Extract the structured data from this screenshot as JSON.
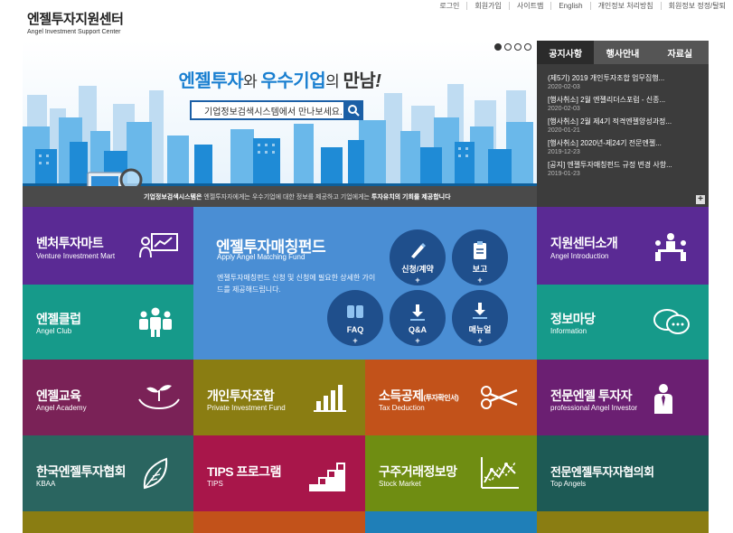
{
  "logo": {
    "ko": "엔젤투자지원센터",
    "en": "Angel Investment Support Center"
  },
  "topnav": [
    "로그인",
    "회원가입",
    "사이트맵",
    "English",
    "개인정보 처리방침",
    "회원정보 정정/탈퇴"
  ],
  "hero": {
    "title_a": "엔젤투자",
    "title_b": "와 ",
    "title_c": "우수기업",
    "title_d": "의 ",
    "title_e": "만남",
    "title_f": "!",
    "search_placeholder": "기업정보검색시스템에서 만나보세요.",
    "caption_bold": "기업정보검색시스템은",
    "caption_mid": " 엔젤투자자에게는 우수기업에 대한 정보를 제공하고 기업에게는 ",
    "caption_end": "투자유치의 기회를 제공합니다",
    "slides": 4,
    "active_slide": 1
  },
  "notice": {
    "tabs": [
      "공지사항",
      "행사안내",
      "자료실"
    ],
    "items": [
      {
        "title": "(제5기) 2019 개인투자조합 업무집행...",
        "date": "2020-02-03"
      },
      {
        "title": "[행사취소] 2월 엔젤리더스포럼 - 신종...",
        "date": "2020-02-03"
      },
      {
        "title": "[행사취소] 2월 제4기 적격엔젤양성과정...",
        "date": "2020-01-21"
      },
      {
        "title": "[행사취소] 2020년-제24기 전문엔젤...",
        "date": "2019-12-23"
      },
      {
        "title": "[공지] 엔젤투자매칭펀드 규정 변경 사항...",
        "date": "2019-01-23"
      }
    ],
    "more": "+"
  },
  "fund": {
    "ko": "엔젤투자매칭펀드",
    "en": "Apply Angel Matching Fund",
    "desc": "엔젤투자매칭펀드 신청 및 신청에 필요한 상세한 가이드를 제공해드립니다.",
    "buttons": [
      "신청/계약",
      "보고",
      "FAQ",
      "Q&A",
      "매뉴얼"
    ],
    "plus": "+"
  },
  "tiles": {
    "venture": {
      "ko": "벤처투자마트",
      "en": "Venture Investment Mart"
    },
    "center": {
      "ko": "지원센터소개",
      "en": "Angel Introduction"
    },
    "club": {
      "ko": "엔젤클럽",
      "en": "Angel Club"
    },
    "info": {
      "ko": "정보마당",
      "en": "Information"
    },
    "edu": {
      "ko": "엔젤교육",
      "en": "Angel Academy"
    },
    "private": {
      "ko": "개인투자조합",
      "en": "Private Investment Fund"
    },
    "tax": {
      "ko": "소득공제",
      "ko_small": "(투자확인서)",
      "en": "Tax Deduction"
    },
    "pro": {
      "ko": "전문엔젤 투자자",
      "en": "professional Angel Investor"
    },
    "kbaa": {
      "ko": "한국엔젤투자협회",
      "en": "KBAA"
    },
    "tips": {
      "ko": "TIPS 프로그램",
      "en": "TIPS"
    },
    "stock": {
      "ko": "구주거래정보망",
      "en": "Stock Market"
    },
    "top": {
      "ko": "전문엔젤투자자협의회",
      "en": "Top Angels"
    }
  },
  "colors": {
    "purple": "#5a2a94",
    "teal": "#169a8a",
    "blue": "#4a8ed4",
    "plum": "#7a2257",
    "olive": "#8a7d12",
    "orange": "#c2521a",
    "deepplum": "#6b1f72",
    "darkteal": "#2a6560",
    "crimson": "#a8164a",
    "green": "#6f8d12",
    "darkgreen": "#1d5a55"
  }
}
